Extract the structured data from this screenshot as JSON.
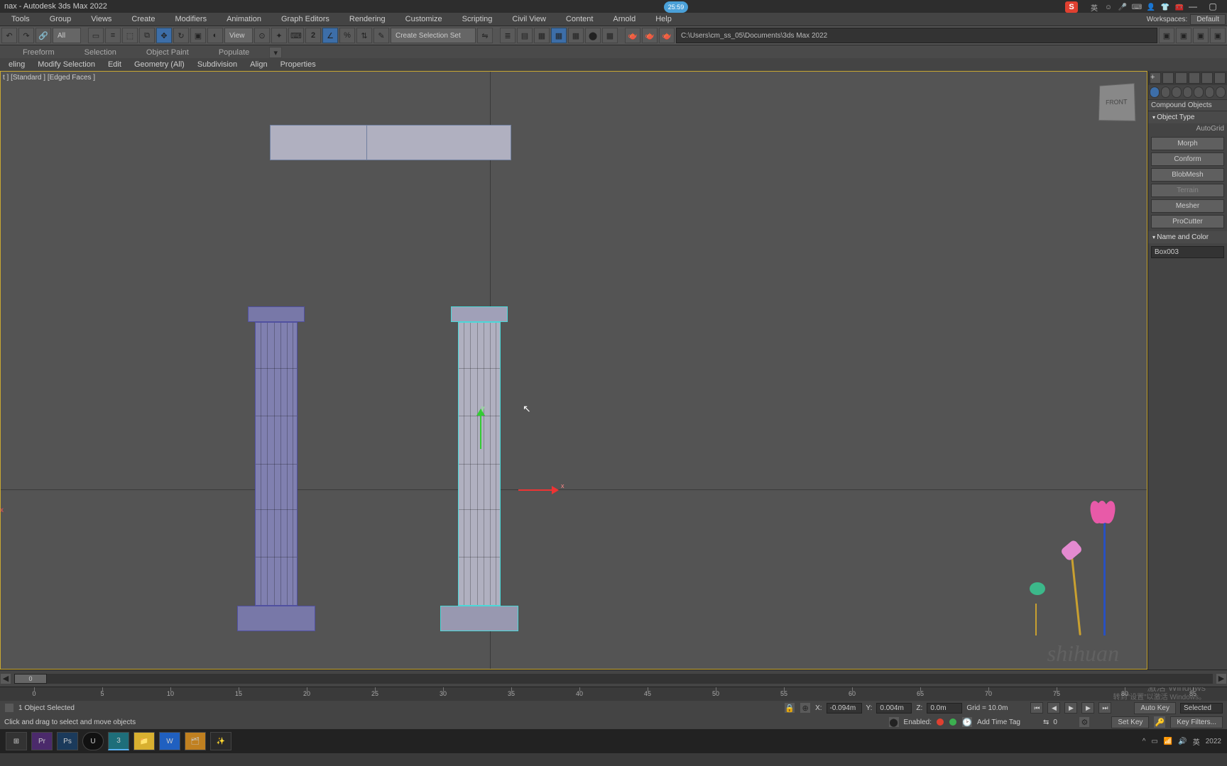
{
  "title": "nax - Autodesk 3ds Max 2022",
  "topbadge": "25:59",
  "menus": [
    "Tools",
    "Group",
    "Views",
    "Create",
    "Modifiers",
    "Animation",
    "Graph Editors",
    "Rendering",
    "Customize",
    "Scripting",
    "Civil View",
    "Content",
    "Arnold",
    "Help"
  ],
  "workspaces_label": "Workspaces:",
  "workspaces_value": "Default",
  "toolbar_all": "All",
  "toolbar_view": "View",
  "toolbar_selset": "Create Selection Set",
  "toolbar_path": "C:\\Users\\cm_ss_05\\Documents\\3ds Max 2022",
  "ribbon_tabs": [
    "Freeform",
    "Selection",
    "Object Paint",
    "Populate"
  ],
  "ribbon_sub": [
    "eling",
    "Modify Selection",
    "Edit",
    "Geometry (All)",
    "Subdivision",
    "Align",
    "Properties"
  ],
  "viewport_label": "t ] [Standard ] [Edged Faces ]",
  "viewcube": "FRONT",
  "watermark": "shihuan",
  "cmd_category": "Compound Objects",
  "roll_objtype": "Object Type",
  "autogrid": "AutoGrid",
  "objbuttons": [
    "Morph",
    "Conform",
    "BlobMesh",
    "Terrain",
    "Mesher",
    "ProCutter"
  ],
  "roll_name": "Name and Color",
  "objname": "Box003",
  "slider_thumb": "0",
  "ruler": [
    "0",
    "5",
    "10",
    "15",
    "20",
    "25",
    "30",
    "35",
    "40",
    "45",
    "50",
    "55",
    "60",
    "65",
    "70",
    "75",
    "80",
    "85"
  ],
  "activate1": "激活 Windows",
  "activate2": "转到\"设置\"以激活 Windows。",
  "status_sel": "1 Object Selected",
  "status_hint": "Click and drag to select and move objects",
  "coord_x_lbl": "X:",
  "coord_x": "-0.094m",
  "coord_y_lbl": "Y:",
  "coord_y": "0.004m",
  "coord_z_lbl": "Z:",
  "coord_z": "0.0m",
  "grid": "Grid = 10.0m",
  "enabled": "Enabled:",
  "addtime": "Add Time Tag",
  "autokey": "Auto Key",
  "selected": "Selected",
  "setkey": "Set Key",
  "keyfilters": "Key Filters...",
  "tray_ime": "英",
  "tray_date": "2022",
  "top_ime_lang": "英"
}
